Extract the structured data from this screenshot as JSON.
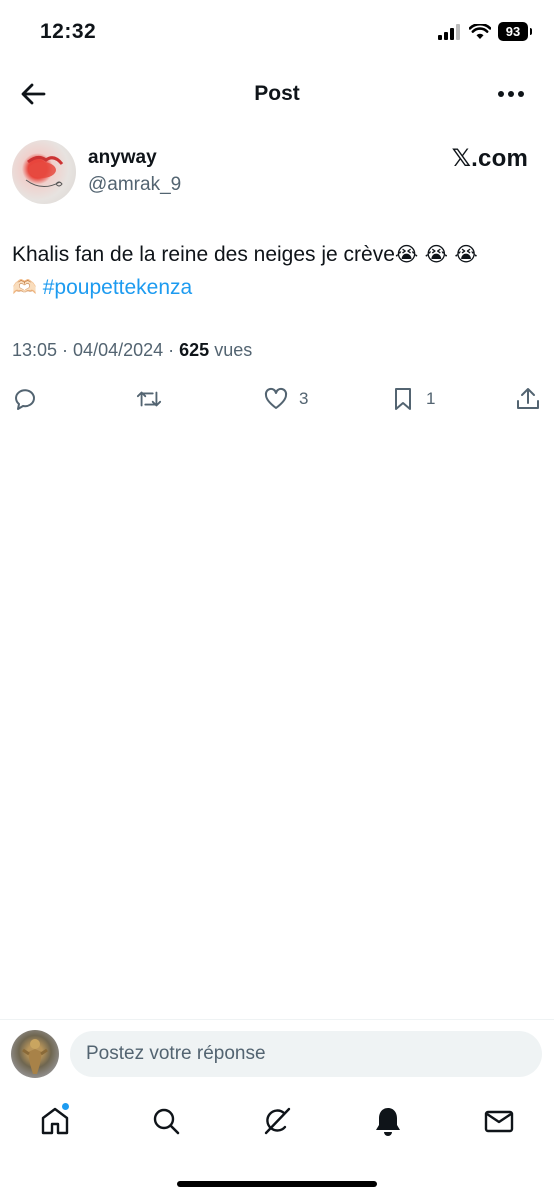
{
  "status_bar": {
    "time": "12:32",
    "battery": "93"
  },
  "header": {
    "title": "Post"
  },
  "author": {
    "display_name": "anyway",
    "handle": "@amrak_9",
    "watermark": "𝕏.com"
  },
  "tweet": {
    "text": "Khalis fan de la reine des neiges je crève",
    "emojis": "😭 😭 😭",
    "hands_emoji": "🫶🏻",
    "hashtag": "#poupettekenza",
    "time": "13:05",
    "date": "04/04/2024",
    "views_count": "625",
    "views_label": "vues"
  },
  "actions": {
    "reply": "",
    "retweet": "",
    "likes": "3",
    "bookmarks": "1"
  },
  "reply_bar": {
    "placeholder": "Postez votre réponse"
  },
  "tab_bar": {
    "items": [
      "home-icon",
      "search-icon",
      "grok-icon",
      "notifications-icon",
      "messages-icon"
    ]
  },
  "colors": {
    "accent": "#1d9bf0",
    "secondary_text": "#536471",
    "primary_text": "#0f1419"
  }
}
